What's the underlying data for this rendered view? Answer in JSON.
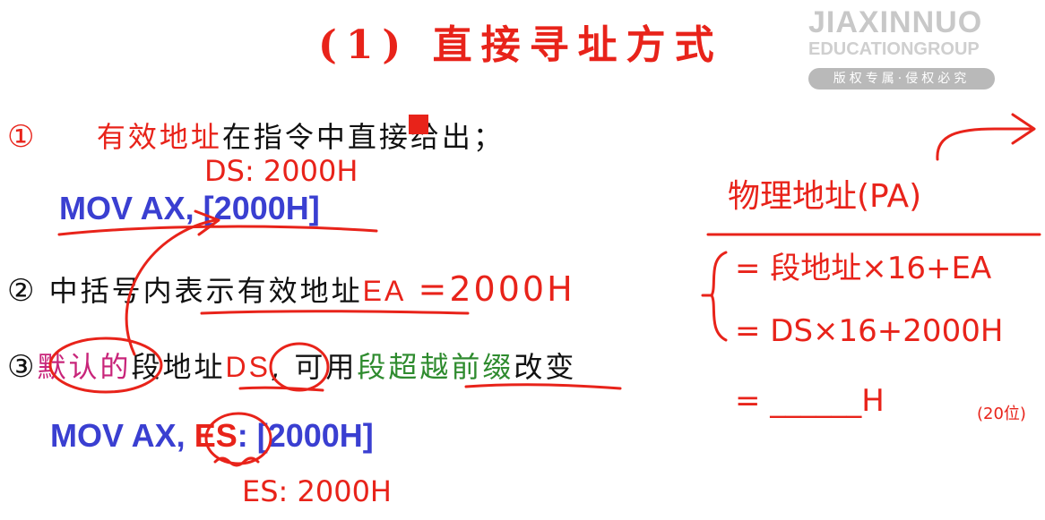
{
  "header": {
    "title": "(1) 直接寻址方式"
  },
  "watermark": {
    "name": "JIAXINNUO",
    "group": "EDUCATIONGROUP",
    "badge": "版权专属·侵权必究"
  },
  "points": {
    "p1": {
      "number": "①",
      "red": "有效地址",
      "black": "在指令中直接给出；"
    },
    "p2": {
      "number": "②",
      "black": "中括号内表示有效地址",
      "red": "EA",
      "value": "=2000H"
    },
    "p3": {
      "number": "③",
      "magenta": "默认的",
      "black1": "段地址",
      "red": "DS",
      "black2": ", 可用",
      "green": "段超越前缀",
      "black3": "改变"
    }
  },
  "code": {
    "mov1": "MOV AX, [2000H]",
    "mov2_prefix": "MOV AX, ",
    "mov2_seg": "ES",
    "mov2_suffix": ": [2000H]"
  },
  "annotations": {
    "ds_value": "DS: 2000H",
    "es_value": "ES: 2000H",
    "pa_label": "物理地址(PA)",
    "eq1": "= 段地址×16+EA",
    "eq2": "= DS×16+2000H",
    "eq3": "= ______H",
    "eq3_note": "(20位)"
  },
  "colors": {
    "red": "#e8231a",
    "blue": "#3a3fd1",
    "green": "#2e8b2e",
    "magenta": "#c8257a"
  }
}
